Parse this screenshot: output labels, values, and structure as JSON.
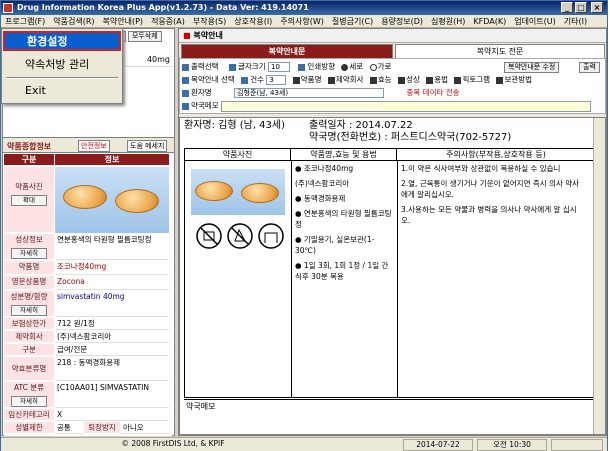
{
  "titlebar": {
    "title": "Drug Information Korea Plus App(v1.2.73) - Data Ver: 419.14071"
  },
  "menu": [
    "프로그램(F)",
    "약품검색(R)",
    "복약안내(P)",
    "적응증(A)",
    "부작용(S)",
    "상호작용(I)",
    "주의사항(W)",
    "질병금기(C)",
    "용량정보(D)",
    "심평원(H)",
    "KFDA(K)",
    "업데이트(U)",
    "기타(I)"
  ],
  "dropdown": {
    "items": [
      "환경설정",
      "약속처방 관리",
      "Exit"
    ]
  },
  "leftpane": {
    "toolbar": {
      "btn1": "검색",
      "btn2": "모두삭제"
    },
    "top_value": "40mg",
    "header": {
      "title": "약품종합정보",
      "btn_safety": "안전정보",
      "btn_help": "도움 메세지"
    },
    "grid_headers": [
      "구분",
      "정보"
    ],
    "rows": [
      {
        "label": "약품사진",
        "value": "",
        "btn": "확대"
      },
      {
        "label": "성상정보",
        "value": "연분홍색의 타원형 필름코팅정",
        "btn": "자세히"
      },
      {
        "label": "약품명",
        "value": "조코나정40mg"
      },
      {
        "label": "영문상품명",
        "value": "Zocona"
      },
      {
        "label": "성분명/함량",
        "value": "simvastatin 40mg",
        "btn": "자세히"
      },
      {
        "label": "보험상한가",
        "value": "712 원/1정"
      },
      {
        "label": "제약회사",
        "value": "(주)넥스팜코리아"
      },
      {
        "label": "구분",
        "value": "급여/전문"
      },
      {
        "label": "약효분류명",
        "value": "218 : 동맥경화용제"
      },
      {
        "label": "ATC 분류",
        "value": "[C10AA01] SIMVASTATIN",
        "btn": "자세히"
      },
      {
        "label": "임신카테고리",
        "value": "X"
      },
      {
        "label": "성별제한",
        "value": "공통",
        "extra_label": "퇴장방지",
        "extra_value": "아니오"
      }
    ]
  },
  "rightpane": {
    "title": "복약안내",
    "tabs": [
      "복약안내문",
      "복약지도 전문"
    ],
    "opts": {
      "print_label": "출력선택",
      "font_label": "글자크기",
      "font_value": "10",
      "print_dir_label": "인쇄방향",
      "portrait": "세로",
      "landscape": "가로",
      "btn_edit": "복약안내문 수정",
      "btn_print": "출력",
      "guide_label": "복약안내 선택",
      "count_label": "건수",
      "count_value": "3",
      "checks": [
        "약품명",
        "제약회사",
        "효능",
        "성상",
        "용법",
        "픽토그램",
        "보관방법"
      ],
      "patient_label": "환자명",
      "patient_value": "김형준(남, 43세)",
      "dup_notice": "중복 데이타 전송",
      "pharmacy_memo_label": "약국메모"
    },
    "output": {
      "patient": "환자명: 김형  (남,  43세)",
      "date_line": "출력일자        : 2014.07.22",
      "pharmacy_line": "약국명(전화번호) : 퍼스트디스약국(702-5727)",
      "col_headers": [
        "약품사진",
        "약품명,효능 및 용법",
        "주의사항(부작용,상호작용 등)"
      ],
      "drug_lines": [
        "● 조코나정40mg",
        "  (주)넥스팜코리아",
        "● 동맥경화용제",
        "● 연분홍색의 타원형 필름코팅정",
        "● 기밀용기, 실온보관(1-30℃)",
        "● 1일 3회, 1회 1정 / 1일 간 식후 30분 복용"
      ],
      "caution_lines": [
        "1.이 약은 식사여부와 상관없이 복용하실 수 있습니",
        "2.열, 근육통이 생기거나 기운이 없어지면 즉시 의사 약사에게 알리십시오.",
        "3.사용하는 모든 약물과 병력을 의사나 약사에게 알 십시오."
      ],
      "memo_label": "약국메모"
    }
  },
  "statusbar": {
    "copyright": "© 2008 FirstDIS Ltd, & KPIF",
    "date": "2014-07-22",
    "time": "오전 10:30"
  }
}
